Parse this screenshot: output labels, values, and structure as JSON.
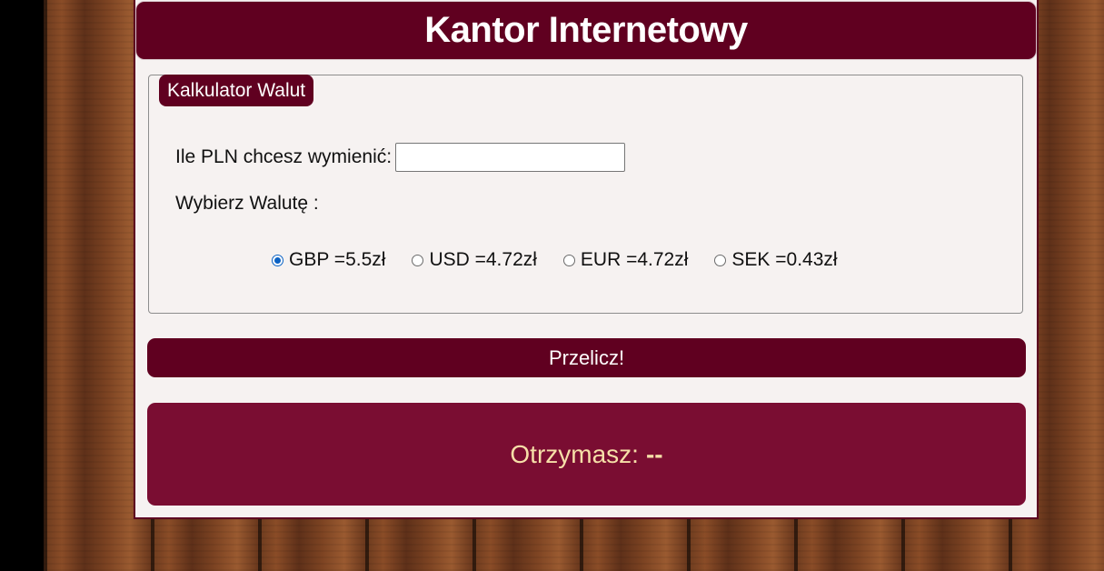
{
  "header": {
    "title": "Kantor Internetowy"
  },
  "calculator": {
    "legend": "Kalkulator Walut",
    "amount_label": "Ile PLN chcesz wymienić:",
    "amount_value": "",
    "currency_label": "Wybierz Walutę :",
    "currencies": [
      {
        "label": "GBP =5.5zł",
        "checked": true
      },
      {
        "label": "USD =4.72zł",
        "checked": false
      },
      {
        "label": "EUR =4.72zł",
        "checked": false
      },
      {
        "label": "SEK =0.43zł",
        "checked": false
      }
    ]
  },
  "convert_button": {
    "label": "Przelicz!"
  },
  "result": {
    "label": "Otrzymasz:",
    "value": "--"
  },
  "colors": {
    "primary": "#600020",
    "result_bg": "#7a0d32",
    "result_text": "#f6dfa8",
    "panel_bg": "#f6f2f1"
  }
}
